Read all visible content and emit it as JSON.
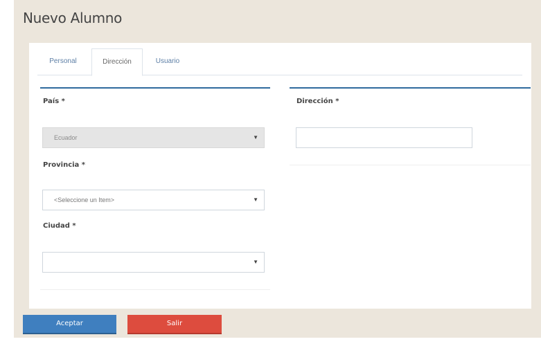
{
  "page": {
    "title": "Nuevo Alumno"
  },
  "tabs": [
    {
      "label": "Personal",
      "active": false
    },
    {
      "label": "Dirección",
      "active": true
    },
    {
      "label": "Usuario",
      "active": false
    }
  ],
  "form": {
    "pais": {
      "label": "País *",
      "value": "Ecuador",
      "disabled": true
    },
    "provincia": {
      "label": "Provincia *",
      "value": "<Seleccione un Item>"
    },
    "ciudad": {
      "label": "Ciudad *",
      "value": ""
    },
    "direccion": {
      "label": "Dirección *",
      "value": ""
    }
  },
  "actions": {
    "accept": "Aceptar",
    "exit": "Salir"
  },
  "colors": {
    "accent": "#2f6a9d",
    "primary_button": "#3f7fbf",
    "danger_button": "#dd4c3e",
    "background": "#ece6dc"
  },
  "icons": {
    "dropdown": "caret-down-icon"
  }
}
